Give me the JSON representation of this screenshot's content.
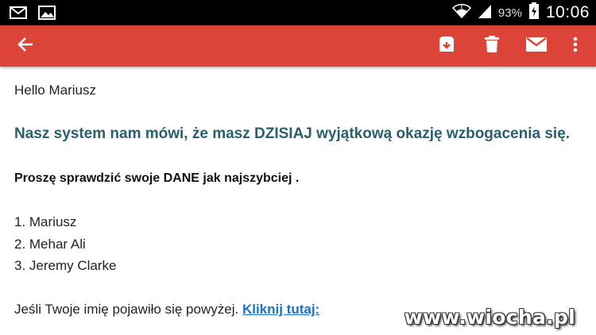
{
  "status_bar": {
    "battery_percent": "93%",
    "time": "10:06",
    "icons": [
      "gmail-notification-icon",
      "gallery-notification-icon",
      "wifi-icon",
      "signal-icon",
      "battery-charging-icon"
    ]
  },
  "app_bar": {
    "color": "#db4437",
    "actions": [
      "back-arrow-icon",
      "archive-icon",
      "delete-icon",
      "mark-unread-icon",
      "more-vert-icon"
    ]
  },
  "email": {
    "greeting": "Hello Mariusz",
    "headline": "Nasz system nam mówi, że masz DZISIAJ wyjątkową okazję wzbogacenia się.",
    "check_text": "Proszę sprawdzić swoje DANE jak najszybciej .",
    "list": [
      "1. Mariusz",
      "2. Mehar Ali",
      "3. Jeremy Clarke"
    ],
    "last_line": "Jeśli Twoje imię pojawiło się powyżej.",
    "link_text": "Kliknij tutaj:"
  },
  "watermark": "www.wiocha.pl"
}
